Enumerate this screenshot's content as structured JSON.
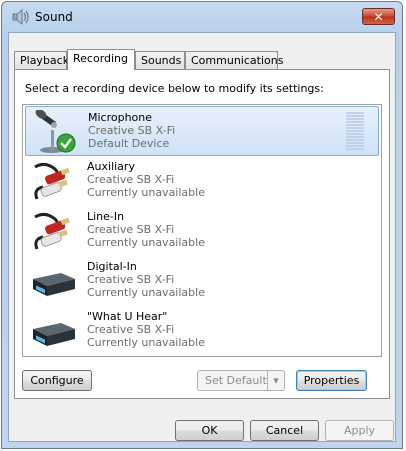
{
  "window": {
    "title": "Sound",
    "close_symbol": "✕"
  },
  "tabs": [
    {
      "label": "Playback",
      "active": false
    },
    {
      "label": "Recording",
      "active": true
    },
    {
      "label": "Sounds",
      "active": false
    },
    {
      "label": "Communications",
      "active": false
    }
  ],
  "instruction": "Select a recording device below to modify its settings:",
  "devices": [
    {
      "name": "Microphone",
      "driver": "Creative SB X-Fi",
      "status": "Default Device",
      "icon": "microphone-icon",
      "selected": true
    },
    {
      "name": "Auxiliary",
      "driver": "Creative SB X-Fi",
      "status": "Currently unavailable",
      "icon": "rca-cable-icon",
      "selected": false
    },
    {
      "name": "Line-In",
      "driver": "Creative SB X-Fi",
      "status": "Currently unavailable",
      "icon": "rca-cable-icon",
      "selected": false
    },
    {
      "name": "Digital-In",
      "driver": "Creative SB X-Fi",
      "status": "Currently unavailable",
      "icon": "digital-device-icon",
      "selected": false
    },
    {
      "name": "\"What U Hear\"",
      "driver": "Creative SB X-Fi",
      "status": "Currently unavailable",
      "icon": "digital-device-icon",
      "selected": false
    }
  ],
  "buttons": {
    "configure": "Configure",
    "set_default": "Set Default",
    "properties": "Properties",
    "ok": "OK",
    "cancel": "Cancel",
    "apply": "Apply"
  },
  "colors": {
    "selection_bg": "#cfe2f7",
    "selection_border": "#84acdd",
    "close_red": "#c9442e",
    "check_green": "#3aa33a"
  }
}
